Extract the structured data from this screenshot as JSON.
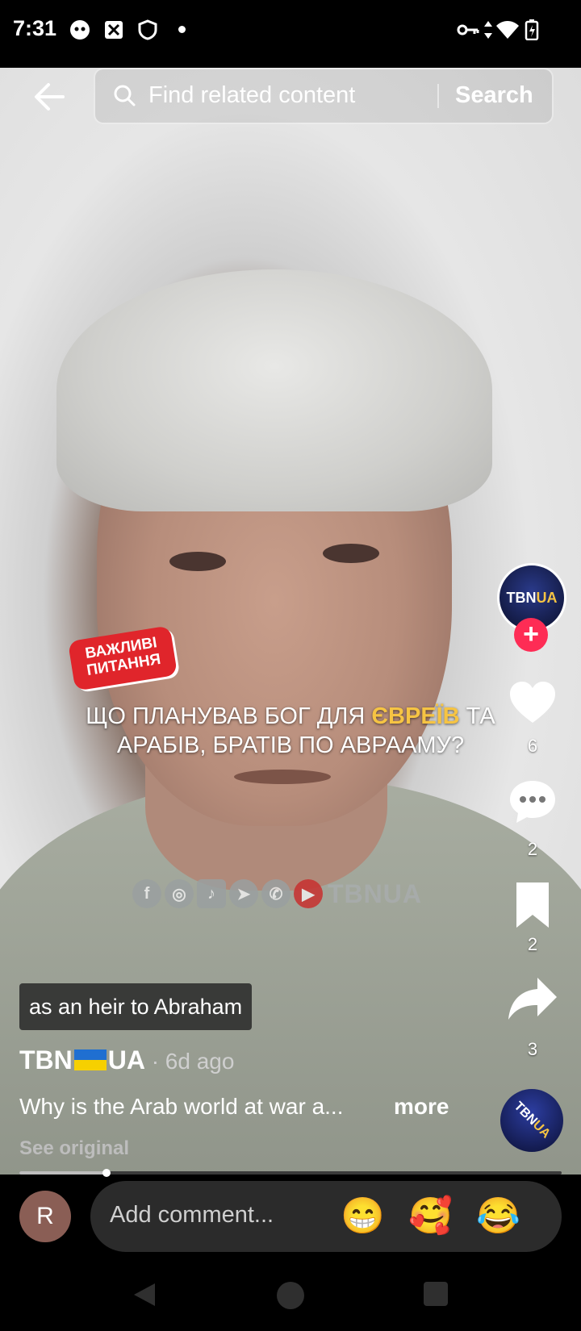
{
  "status_bar": {
    "time": "7:31"
  },
  "search": {
    "placeholder": "Find related content",
    "button": "Search"
  },
  "overlay": {
    "sticker_line1": "ВАЖЛИВІ",
    "sticker_line2": "ПИТАННЯ",
    "caption_part1": "ЩО ПЛАНУВАВ БОГ ДЛЯ ",
    "caption_highlight": "ЄВРЕЇВ",
    "caption_part2": " ТА",
    "caption_line2": "АРАБІВ, БРАТІВ ПО АВРААМУ?",
    "watermark": "TBNUA"
  },
  "creator": {
    "avatar_text_1": "TBN",
    "avatar_text_2": "UA"
  },
  "actions": {
    "likes": "6",
    "comments": "2",
    "saves": "2",
    "shares": "3"
  },
  "post": {
    "tag": "as an heir to Abraham",
    "author_1": "TBN",
    "author_2": "UA",
    "ago": "· 6d ago",
    "description": "Why is the Arab world at war a...",
    "more": "more",
    "see_original": "See original",
    "progress": 0.16
  },
  "comment": {
    "avatar_letter": "R",
    "placeholder": "Add comment...",
    "emojis": [
      "😁",
      "🥰",
      "😂"
    ]
  },
  "colors": {
    "accent": "#fe2c55",
    "highlight": "#f6c443"
  }
}
